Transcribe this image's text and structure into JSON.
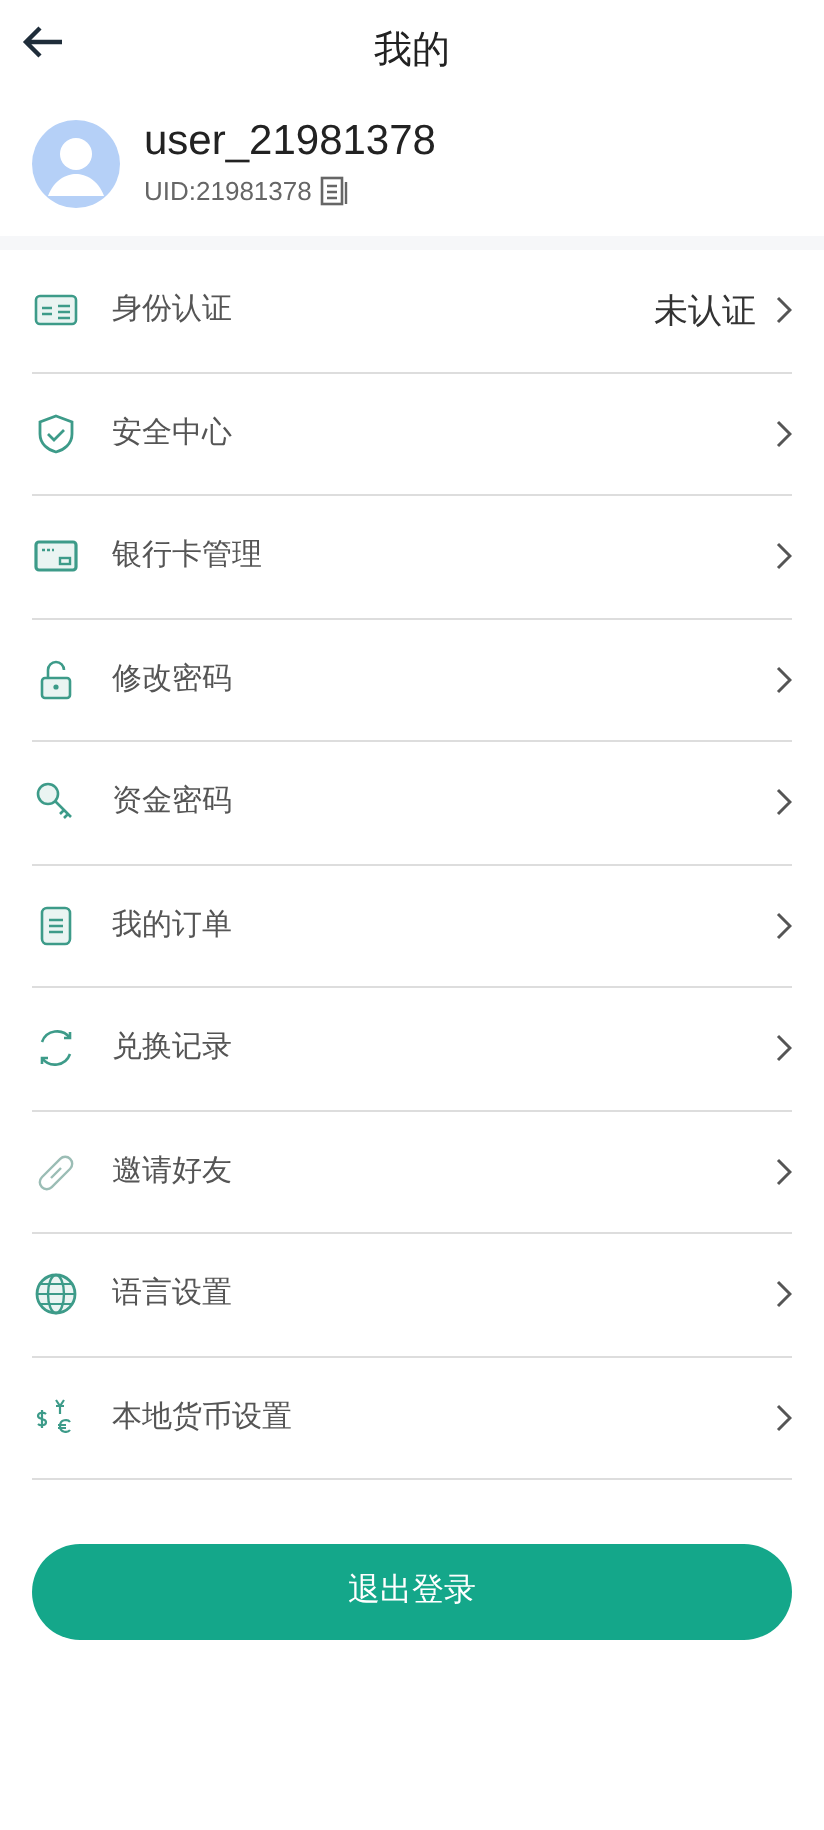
{
  "header": {
    "title": "我的"
  },
  "profile": {
    "username": "user_21981378",
    "uid": "UID:21981378"
  },
  "menu": [
    {
      "label": "身份认证",
      "value": "未认证"
    },
    {
      "label": "安全中心"
    },
    {
      "label": "银行卡管理"
    },
    {
      "label": "修改密码"
    },
    {
      "label": "资金密码"
    },
    {
      "label": "我的订单"
    },
    {
      "label": "兑换记录"
    },
    {
      "label": "邀请好友"
    },
    {
      "label": "语言设置"
    },
    {
      "label": "本地货币设置"
    }
  ],
  "logout_button": "退出登录"
}
